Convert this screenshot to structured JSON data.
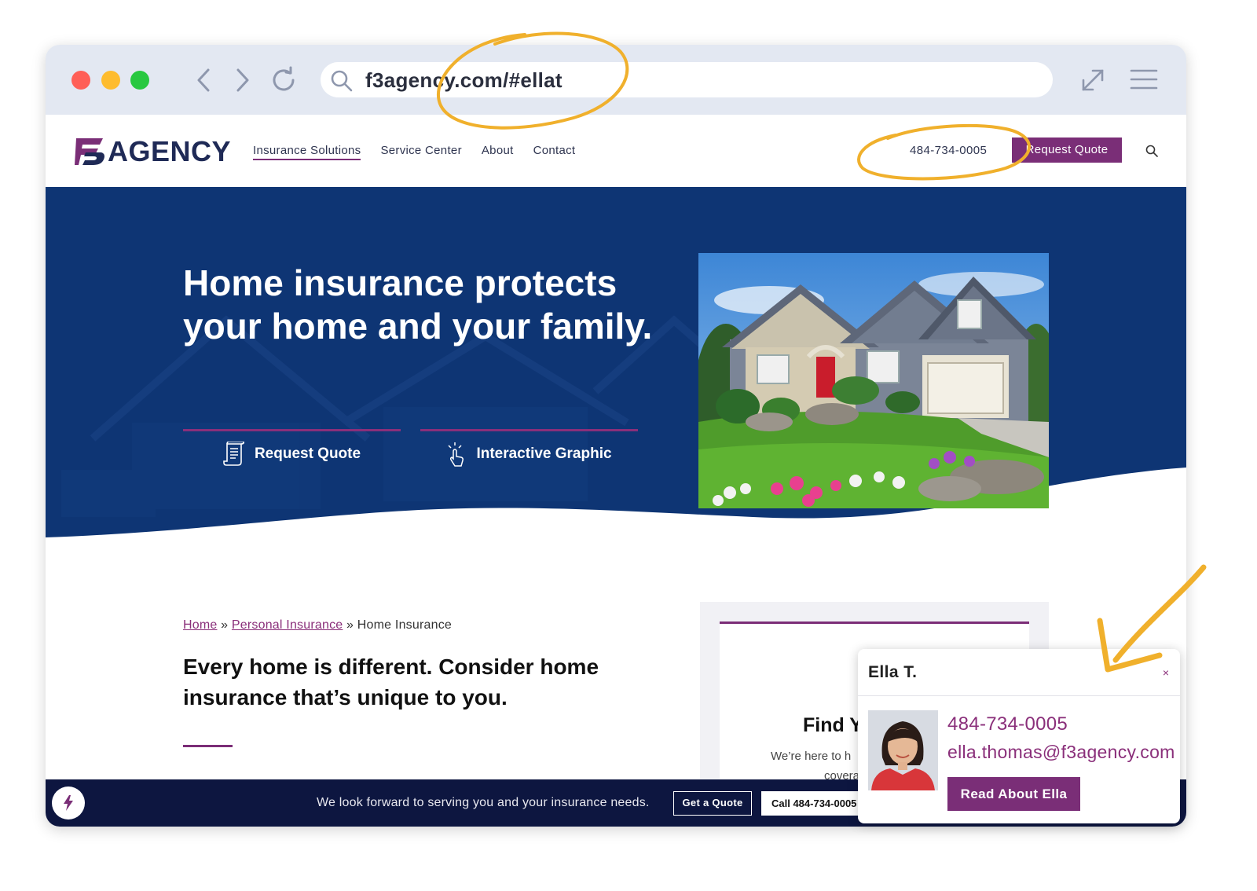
{
  "browser": {
    "url": "f3agency.com/#ellat"
  },
  "header": {
    "logo_text": "AGENCY",
    "nav": [
      {
        "label": "Insurance Solutions"
      },
      {
        "label": "Service Center"
      },
      {
        "label": "About"
      },
      {
        "label": "Contact"
      }
    ],
    "phone": "484-734-0005",
    "quote_label": "Request Quote"
  },
  "hero": {
    "title": "Home insurance protects your home and your family.",
    "buttons": [
      {
        "label": "Request Quote",
        "icon": "document-icon"
      },
      {
        "label": "Interactive Graphic",
        "icon": "pointer-click-icon"
      }
    ]
  },
  "content": {
    "breadcrumb": {
      "home": "Home",
      "sep1": "»",
      "personal": "Personal Insurance",
      "sep2": "»",
      "current": "Home Insurance"
    },
    "title": "Every home is different. Consider home insurance that’s unique to you."
  },
  "side_card": {
    "title": "Find You",
    "line1": "We’re here to h",
    "line2": "covera"
  },
  "bottom_bar": {
    "message": "We look forward to serving you and your insurance needs.",
    "quote_btn": "Get a Quote",
    "call_btn": "Call 484-734-0005"
  },
  "popup": {
    "name": "Ella T.",
    "close": "×",
    "phone": "484-734-0005",
    "email": "ella.thomas@f3agency.com",
    "button": "Read About Ella"
  },
  "colors": {
    "brand_purple": "#7a2e77",
    "hero_navy": "#0e3574",
    "bar_navy": "#0d1640",
    "annotation_gold": "#f0b02c"
  }
}
